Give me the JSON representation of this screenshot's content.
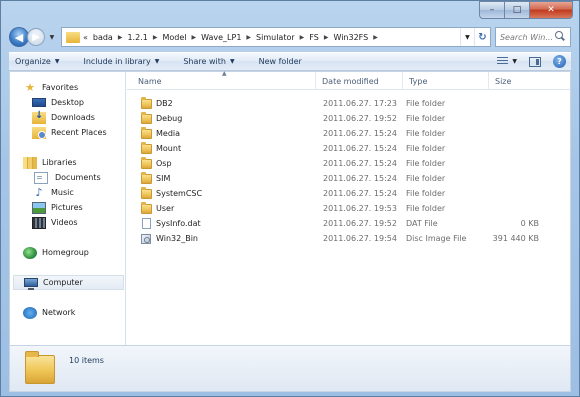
{
  "window": {
    "caption": {
      "minimize": "–",
      "maximize": "□",
      "close": "✕"
    }
  },
  "address": {
    "overflow": "«",
    "crumbs": [
      "bada",
      "1.2.1",
      "Model",
      "Wave_LP1",
      "Simulator",
      "FS",
      "Win32FS"
    ]
  },
  "search": {
    "placeholder": "Search Win..."
  },
  "commands": {
    "organize": "Organize",
    "include_in_library": "Include in library",
    "share_with": "Share with",
    "new_folder": "New folder"
  },
  "nav": {
    "favorites": "Favorites",
    "desktop": "Desktop",
    "downloads": "Downloads",
    "recent_places": "Recent Places",
    "libraries": "Libraries",
    "documents": "Documents",
    "music": "Music",
    "pictures": "Pictures",
    "videos": "Videos",
    "homegroup": "Homegroup",
    "computer": "Computer",
    "network": "Network"
  },
  "columns": {
    "name": "Name",
    "date": "Date modified",
    "type": "Type",
    "size": "Size"
  },
  "files": [
    {
      "name": "DB2",
      "date": "2011.06.27. 17:23",
      "type": "File folder",
      "size": "",
      "icon": "folder-icon"
    },
    {
      "name": "Debug",
      "date": "2011.06.27. 19:52",
      "type": "File folder",
      "size": "",
      "icon": "folder-icon"
    },
    {
      "name": "Media",
      "date": "2011.06.27. 15:24",
      "type": "File folder",
      "size": "",
      "icon": "folder-icon"
    },
    {
      "name": "Mount",
      "date": "2011.06.27. 15:24",
      "type": "File folder",
      "size": "",
      "icon": "folder-icon"
    },
    {
      "name": "Osp",
      "date": "2011.06.27. 15:24",
      "type": "File folder",
      "size": "",
      "icon": "folder-icon"
    },
    {
      "name": "SIM",
      "date": "2011.06.27. 15:24",
      "type": "File folder",
      "size": "",
      "icon": "folder-icon"
    },
    {
      "name": "SystemCSC",
      "date": "2011.06.27. 15:24",
      "type": "File folder",
      "size": "",
      "icon": "folder-icon"
    },
    {
      "name": "User",
      "date": "2011.06.27. 19:53",
      "type": "File folder",
      "size": "",
      "icon": "folder-icon"
    },
    {
      "name": "SysInfo.dat",
      "date": "2011.06.27. 19:52",
      "type": "DAT File",
      "size": "0 KB",
      "icon": "file-icon"
    },
    {
      "name": "Win32_Bin",
      "date": "2011.06.27. 19:54",
      "type": "Disc Image File",
      "size": "391 440 KB",
      "icon": "disc-image-icon"
    }
  ],
  "details": {
    "item_count": "10 items"
  }
}
